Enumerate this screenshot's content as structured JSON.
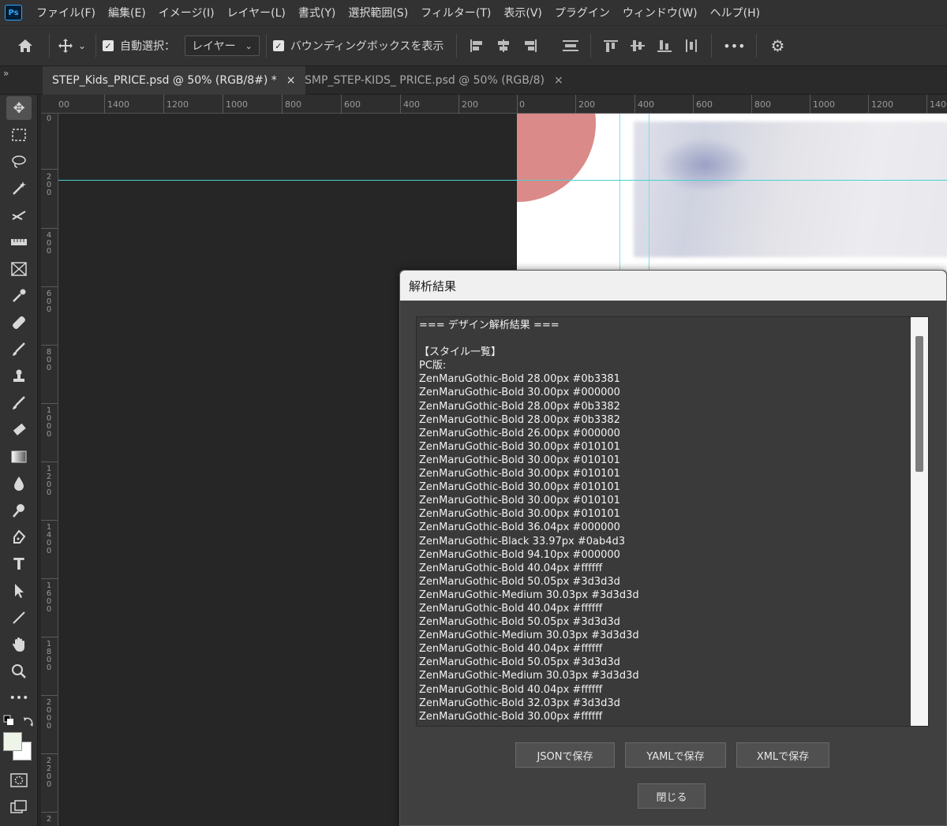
{
  "app": {
    "logo": "Ps"
  },
  "menu": [
    "ファイル(F)",
    "編集(E)",
    "イメージ(I)",
    "レイヤー(L)",
    "書式(Y)",
    "選択範囲(S)",
    "フィルター(T)",
    "表示(V)",
    "プラグイン",
    "ウィンドウ(W)",
    "ヘルプ(H)"
  ],
  "options": {
    "auto_select_label": "自動選択：",
    "auto_select_target": "レイヤー",
    "bounding_box_label": "バウンディングボックスを表示",
    "more": "•••"
  },
  "tabs": [
    {
      "label": "STEP_Kids_PRICE.psd @ 50% (RGB/8#) *",
      "close": "×"
    },
    {
      "label": "SMP_STEP-KIDS_ PRICE.psd @ 50% (RGB/8)",
      "close": "×"
    }
  ],
  "tabs_toggle": "»",
  "ruler_top": [
    "00",
    "1400",
    "1200",
    "1000",
    "800",
    "600",
    "400",
    "200",
    "0",
    "200",
    "400",
    "600",
    "800",
    "1000",
    "1200",
    "1400"
  ],
  "ruler_left": [
    "0",
    "200",
    "400",
    "600",
    "800",
    "1000",
    "1200",
    "1400",
    "1600",
    "1800",
    "2000",
    "2200",
    "2"
  ],
  "dialog": {
    "title": "解析結果",
    "lines": [
      "=== デザイン解析結果 ===",
      "",
      "【スタイル一覧】",
      "PC版:",
      "ZenMaruGothic-Bold 28.00px #0b3381",
      "ZenMaruGothic-Bold 30.00px #000000",
      "ZenMaruGothic-Bold 28.00px #0b3382",
      "ZenMaruGothic-Bold 28.00px #0b3382",
      "ZenMaruGothic-Bold 26.00px #000000",
      "ZenMaruGothic-Bold 30.00px #010101",
      "ZenMaruGothic-Bold 30.00px #010101",
      "ZenMaruGothic-Bold 30.00px #010101",
      "ZenMaruGothic-Bold 30.00px #010101",
      "ZenMaruGothic-Bold 30.00px #010101",
      "ZenMaruGothic-Bold 30.00px #010101",
      "ZenMaruGothic-Bold 36.04px #000000",
      "ZenMaruGothic-Black 33.97px #0ab4d3",
      "ZenMaruGothic-Bold 94.10px #000000",
      "ZenMaruGothic-Bold 40.04px #ffffff",
      "ZenMaruGothic-Bold 50.05px #3d3d3d",
      "ZenMaruGothic-Medium 30.03px #3d3d3d",
      "ZenMaruGothic-Bold 40.04px #ffffff",
      "ZenMaruGothic-Bold 50.05px #3d3d3d",
      "ZenMaruGothic-Medium 30.03px #3d3d3d",
      "ZenMaruGothic-Bold 40.04px #ffffff",
      "ZenMaruGothic-Bold 50.05px #3d3d3d",
      "ZenMaruGothic-Medium 30.03px #3d3d3d",
      "ZenMaruGothic-Bold 40.04px #ffffff",
      "ZenMaruGothic-Bold 32.03px #3d3d3d",
      "ZenMaruGothic-Bold 30.00px #ffffff"
    ],
    "buttons": {
      "json": "JSONで保存",
      "yaml": "YAMLで保存",
      "xml": "XMLで保存",
      "close": "閉じる"
    }
  },
  "colors": {
    "accent_circle": "#da8a88",
    "guide": "#4ad1d1"
  }
}
